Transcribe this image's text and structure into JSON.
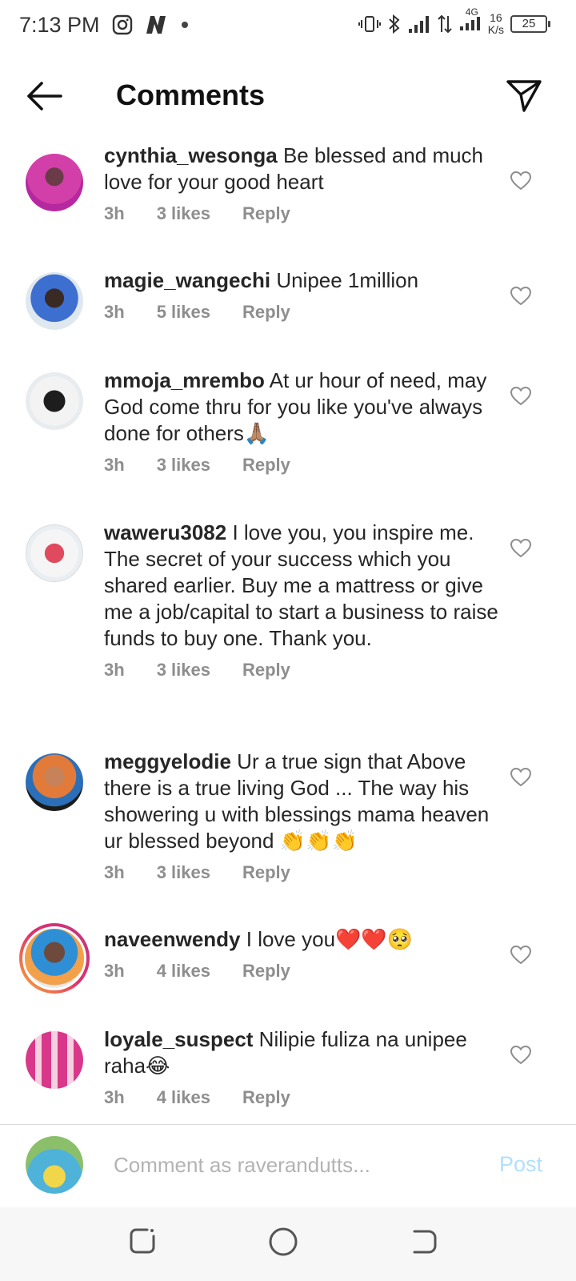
{
  "status_bar": {
    "time": "7:13 PM",
    "network_type": "4G",
    "net_speed_value": "16",
    "net_speed_unit": "K/s",
    "battery": "25",
    "icons": [
      "instagram-icon",
      "notification-n-icon",
      "vibrate-icon",
      "bluetooth-icon",
      "signal-icon",
      "data-arrows-icon",
      "signal-4g-icon"
    ]
  },
  "header": {
    "title": "Comments"
  },
  "comments": [
    {
      "username": "cynthia_wesonga",
      "text": "Be blessed and much love for your good heart",
      "time": "3h",
      "likes": "3 likes",
      "reply": "Reply"
    },
    {
      "username": "magie_wangechi",
      "text": "Unipee 1million",
      "time": "3h",
      "likes": "5 likes",
      "reply": "Reply"
    },
    {
      "username": "mmoja_mrembo",
      "text": "At ur hour of need, may God come thru for you like you've always done for others🙏🏽",
      "time": "3h",
      "likes": "3 likes",
      "reply": "Reply"
    },
    {
      "username": "waweru3082",
      "text": "I love you, you inspire me. The secret of your success which you shared earlier. Buy me a mattress or give me a job/capital to start a business to raise funds to buy one. Thank you.",
      "time": "3h",
      "likes": "3 likes",
      "reply": "Reply"
    },
    {
      "username": "meggyelodie",
      "text": "Ur a true sign that Above there is a true living God ... The way his showering u with blessings mama heaven ur blessed beyond 👏👏👏",
      "time": "3h",
      "likes": "3 likes",
      "reply": "Reply"
    },
    {
      "username": "naveenwendy",
      "text": "I love you❤️❤️🥺",
      "time": "3h",
      "likes": "4 likes",
      "reply": "Reply"
    },
    {
      "username": "loyale_suspect",
      "text": "Nilipie fuliza na unipee raha😂",
      "time": "3h",
      "likes": "4 likes",
      "reply": "Reply"
    }
  ],
  "comment_bar": {
    "placeholder": "Comment as raverandutts...",
    "post_label": "Post"
  },
  "colors": {
    "accent_post": "#b2dffc",
    "meta_gray": "#8e8e8e",
    "story_ring": "#e1306c"
  }
}
